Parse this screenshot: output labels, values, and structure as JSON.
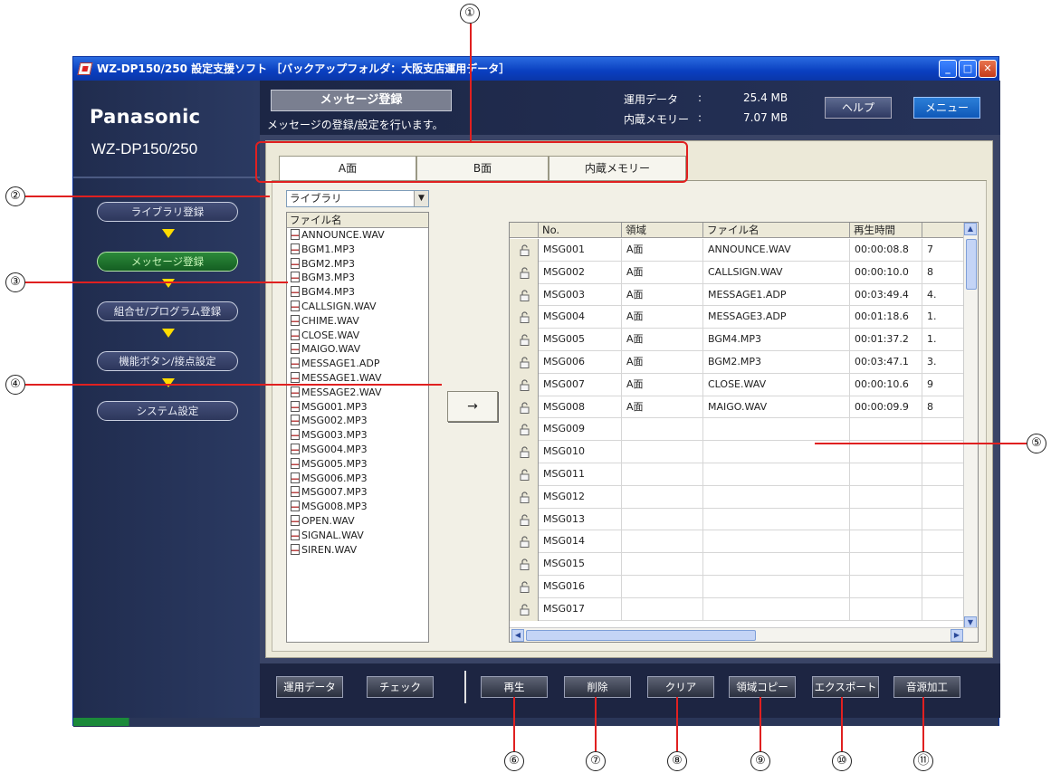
{
  "window": {
    "title": "WZ-DP150/250 設定支援ソフト ［バックアップフォルダ：大阪支店運用データ］",
    "min_label": "_",
    "max_label": "□",
    "close_label": "✕"
  },
  "sidebar": {
    "brand": "Panasonic",
    "model": "WZ-DP150/250",
    "items": [
      {
        "label": "ライブラリ登録"
      },
      {
        "label": "メッセージ登録"
      },
      {
        "label": "組合せ/プログラム登録"
      },
      {
        "label": "機能ボタン/接点設定"
      },
      {
        "label": "システム設定"
      }
    ]
  },
  "header": {
    "page_title": "メッセージ登録",
    "page_desc": "メッセージの登録/設定を行います。",
    "op_data_label": "運用データ",
    "op_data_sep": ":",
    "op_data_value": "25.4 MB",
    "memory_label": "内蔵メモリー",
    "memory_sep": ":",
    "memory_value": "7.07 MB",
    "help_label": "ヘルプ",
    "menu_label": "メニュー"
  },
  "tabs": [
    {
      "label": "A面"
    },
    {
      "label": "B面"
    },
    {
      "label": "内蔵メモリー"
    }
  ],
  "library": {
    "select_value": "ライブラリ",
    "column_header": "ファイル名",
    "files": [
      "ANNOUNCE.WAV",
      "BGM1.MP3",
      "BGM2.MP3",
      "BGM3.MP3",
      "BGM4.MP3",
      "CALLSIGN.WAV",
      "CHIME.WAV",
      "CLOSE.WAV",
      "MAIGO.WAV",
      "MESSAGE1.ADP",
      "MESSAGE1.WAV",
      "MESSAGE2.WAV",
      "MSG001.MP3",
      "MSG002.MP3",
      "MSG003.MP3",
      "MSG004.MP3",
      "MSG005.MP3",
      "MSG006.MP3",
      "MSG007.MP3",
      "MSG008.MP3",
      "OPEN.WAV",
      "SIGNAL.WAV",
      "SIREN.WAV"
    ]
  },
  "arrow_button": "→",
  "message_table": {
    "columns": [
      "No.",
      "領域",
      "ファイル名",
      "再生時間"
    ],
    "rows": [
      {
        "no": "MSG001",
        "area": "A面",
        "file": "ANNOUNCE.WAV",
        "time": "00:00:08.8",
        "extra": "7"
      },
      {
        "no": "MSG002",
        "area": "A面",
        "file": "CALLSIGN.WAV",
        "time": "00:00:10.0",
        "extra": "8"
      },
      {
        "no": "MSG003",
        "area": "A面",
        "file": "MESSAGE1.ADP",
        "time": "00:03:49.4",
        "extra": "4."
      },
      {
        "no": "MSG004",
        "area": "A面",
        "file": "MESSAGE3.ADP",
        "time": "00:01:18.6",
        "extra": "1."
      },
      {
        "no": "MSG005",
        "area": "A面",
        "file": "BGM4.MP3",
        "time": "00:01:37.2",
        "extra": "1."
      },
      {
        "no": "MSG006",
        "area": "A面",
        "file": "BGM2.MP3",
        "time": "00:03:47.1",
        "extra": "3."
      },
      {
        "no": "MSG007",
        "area": "A面",
        "file": "CLOSE.WAV",
        "time": "00:00:10.6",
        "extra": "9"
      },
      {
        "no": "MSG008",
        "area": "A面",
        "file": "MAIGO.WAV",
        "time": "00:00:09.9",
        "extra": "8"
      },
      {
        "no": "MSG009",
        "area": "",
        "file": "",
        "time": "",
        "extra": ""
      },
      {
        "no": "MSG010",
        "area": "",
        "file": "",
        "time": "",
        "extra": ""
      },
      {
        "no": "MSG011",
        "area": "",
        "file": "",
        "time": "",
        "extra": ""
      },
      {
        "no": "MSG012",
        "area": "",
        "file": "",
        "time": "",
        "extra": ""
      },
      {
        "no": "MSG013",
        "area": "",
        "file": "",
        "time": "",
        "extra": ""
      },
      {
        "no": "MSG014",
        "area": "",
        "file": "",
        "time": "",
        "extra": ""
      },
      {
        "no": "MSG015",
        "area": "",
        "file": "",
        "time": "",
        "extra": ""
      },
      {
        "no": "MSG016",
        "area": "",
        "file": "",
        "time": "",
        "extra": ""
      },
      {
        "no": "MSG017",
        "area": "",
        "file": "",
        "time": "",
        "extra": ""
      }
    ]
  },
  "toolbar": {
    "op_data": "運用データ",
    "check": "チェック",
    "play": "再生",
    "delete": "削除",
    "clear": "クリア",
    "area_copy": "領域コピー",
    "export": "エクスポート",
    "sound_edit": "音源加工"
  },
  "callouts": [
    "①",
    "②",
    "③",
    "④",
    "⑤",
    "⑥",
    "⑦",
    "⑧",
    "⑨",
    "⑩",
    "⑪"
  ],
  "colors": {
    "callout_line": "#e02020",
    "sidebar_bg": "#202c4e",
    "active_nav": "#145e22",
    "nav_arrow": "#ffdc00",
    "titlebar": "#0a3fc0"
  }
}
